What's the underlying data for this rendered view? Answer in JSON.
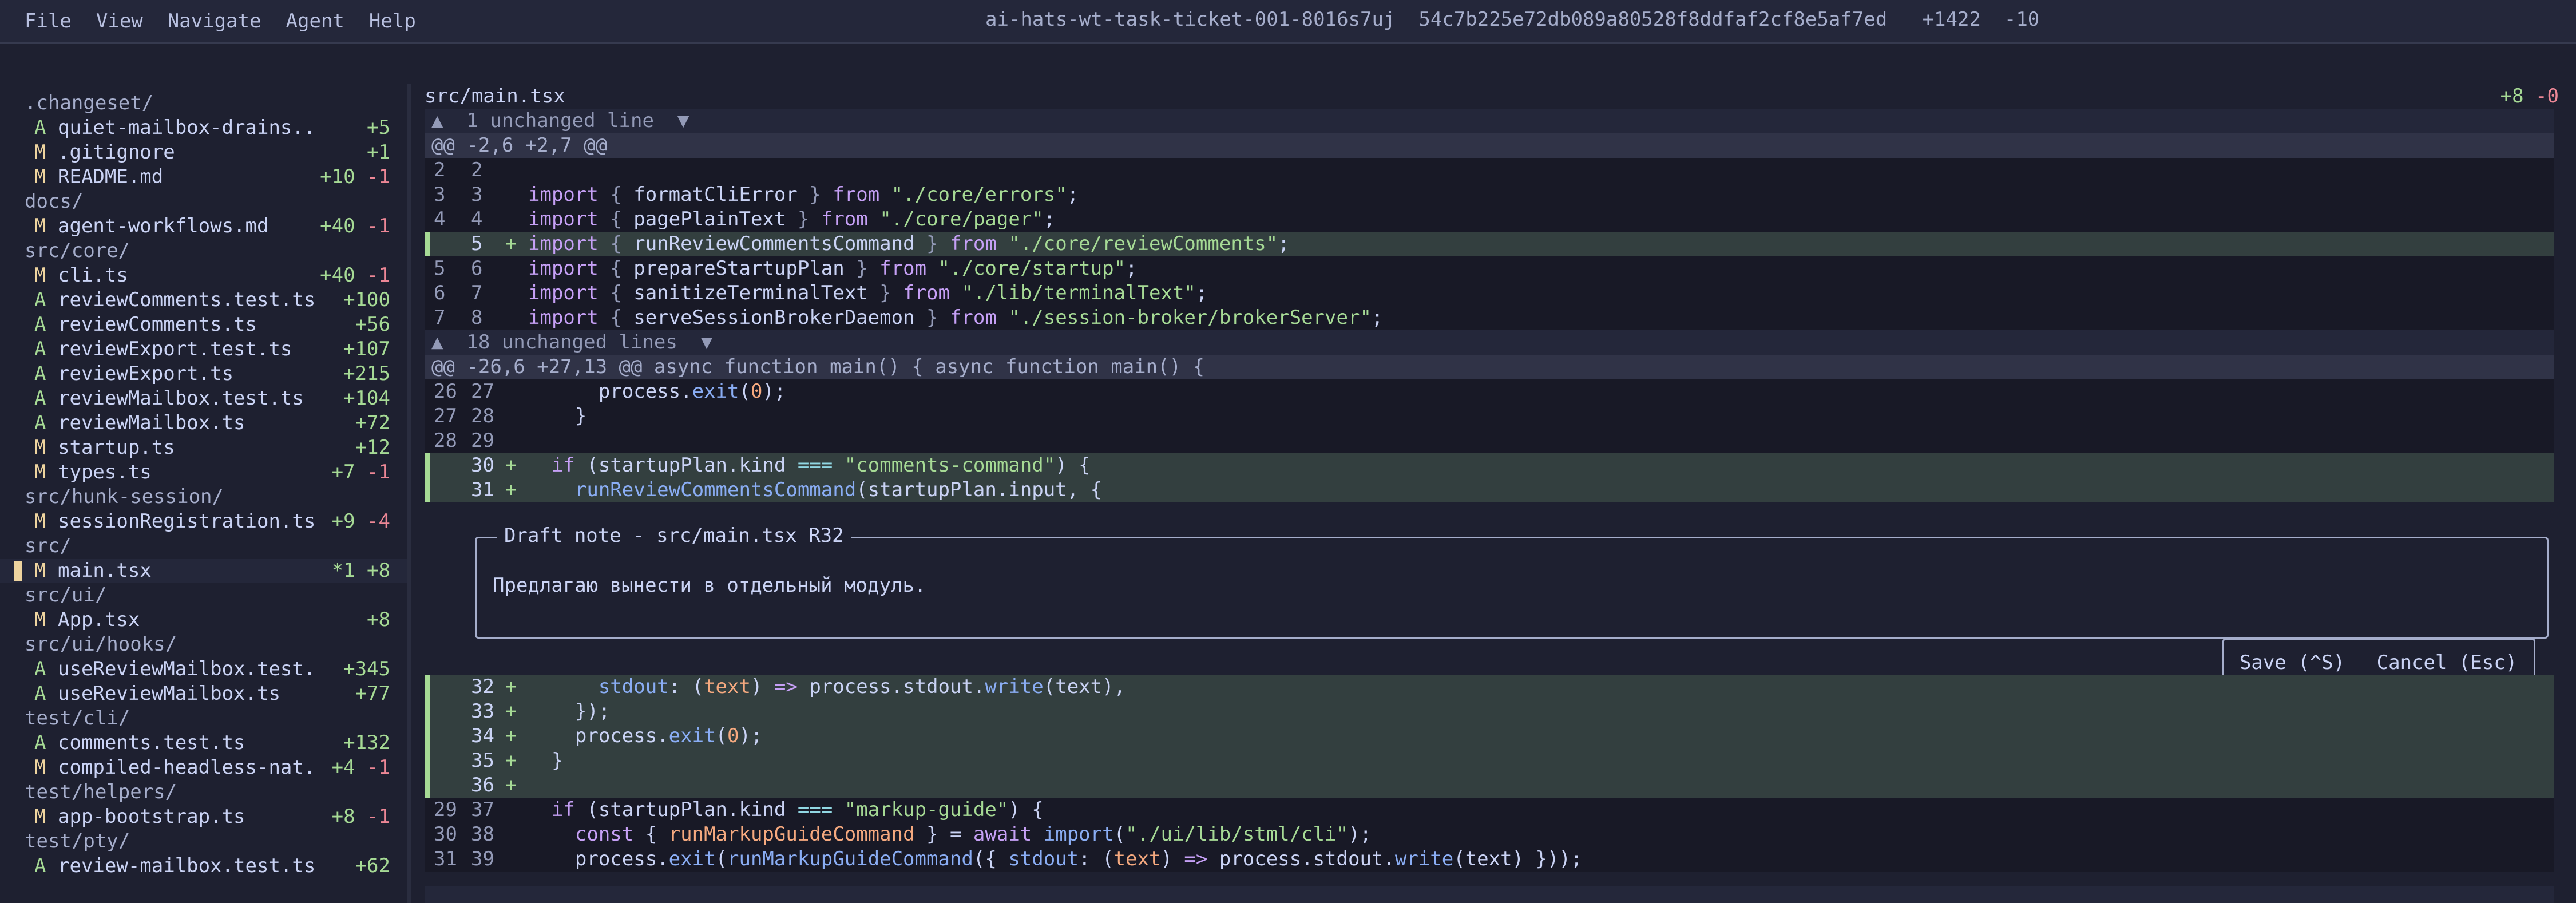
{
  "menu": [
    "File",
    "View",
    "Navigate",
    "Agent",
    "Help"
  ],
  "window_title": "ai-hats-wt-task-ticket-001-8016s7uj  54c7b225e72db089a80528f8ddfaf2cf8e5af7ed   +1422  -10",
  "sidebar": [
    {
      "type": "dir",
      "name": ".changeset/"
    },
    {
      "type": "file",
      "status": "A",
      "name": "quiet-mailbox-drains..",
      "add": "+5",
      "del": ""
    },
    {
      "type": "file",
      "status": "M",
      "name": ".gitignore",
      "add": "+1",
      "del": ""
    },
    {
      "type": "file",
      "status": "M",
      "name": "README.md",
      "add": "+10",
      "del": "-1"
    },
    {
      "type": "dir",
      "name": "docs/"
    },
    {
      "type": "file",
      "status": "M",
      "name": "agent-workflows.md",
      "add": "+40",
      "del": "-1"
    },
    {
      "type": "dir",
      "name": "src/core/"
    },
    {
      "type": "file",
      "status": "M",
      "name": "cli.ts",
      "add": "+40",
      "del": "-1"
    },
    {
      "type": "file",
      "status": "A",
      "name": "reviewComments.test.ts",
      "add": "+100",
      "del": ""
    },
    {
      "type": "file",
      "status": "A",
      "name": "reviewComments.ts",
      "add": "+56",
      "del": ""
    },
    {
      "type": "file",
      "status": "A",
      "name": "reviewExport.test.ts",
      "add": "+107",
      "del": ""
    },
    {
      "type": "file",
      "status": "A",
      "name": "reviewExport.ts",
      "add": "+215",
      "del": ""
    },
    {
      "type": "file",
      "status": "A",
      "name": "reviewMailbox.test.ts",
      "add": "+104",
      "del": ""
    },
    {
      "type": "file",
      "status": "A",
      "name": "reviewMailbox.ts",
      "add": "+72",
      "del": ""
    },
    {
      "type": "file",
      "status": "M",
      "name": "startup.ts",
      "add": "+12",
      "del": ""
    },
    {
      "type": "file",
      "status": "M",
      "name": "types.ts",
      "add": "+7",
      "del": "-1"
    },
    {
      "type": "dir",
      "name": "src/hunk-session/"
    },
    {
      "type": "file",
      "status": "M",
      "name": "sessionRegistration.ts",
      "add": "+9",
      "del": "-4"
    },
    {
      "type": "dir",
      "name": "src/"
    },
    {
      "type": "file",
      "status": "M",
      "name": "main.tsx",
      "add": "*1 +8",
      "del": "",
      "selected": true
    },
    {
      "type": "dir",
      "name": "src/ui/"
    },
    {
      "type": "file",
      "status": "M",
      "name": "App.tsx",
      "add": "+8",
      "del": ""
    },
    {
      "type": "dir",
      "name": "src/ui/hooks/"
    },
    {
      "type": "file",
      "status": "A",
      "name": "useReviewMailbox.test.",
      "add": "+345",
      "del": ""
    },
    {
      "type": "file",
      "status": "A",
      "name": "useReviewMailbox.ts",
      "add": "+77",
      "del": ""
    },
    {
      "type": "dir",
      "name": "test/cli/"
    },
    {
      "type": "file",
      "status": "A",
      "name": "comments.test.ts",
      "add": "+132",
      "del": ""
    },
    {
      "type": "file",
      "status": "M",
      "name": "compiled-headless-nat.",
      "add": "+4",
      "del": "-1"
    },
    {
      "type": "dir",
      "name": "test/helpers/"
    },
    {
      "type": "file",
      "status": "M",
      "name": "app-bootstrap.ts",
      "add": "+8",
      "del": "-1"
    },
    {
      "type": "dir",
      "name": "test/pty/"
    },
    {
      "type": "file",
      "status": "A",
      "name": "review-mailbox.test.ts",
      "add": "+62",
      "del": ""
    }
  ],
  "diff": {
    "file": "src/main.tsx",
    "add": "+8",
    "del": "-0",
    "fold1": "▲  1 unchanged line  ▼",
    "hunk1": "@@ -2,6 +2,7 @@",
    "fold2": "▲  18 unchanged lines  ▼",
    "hunk2": "@@ -26,6 +27,13 @@ async function main() { async function main() {"
  },
  "note": {
    "legend": "Draft note - src/main.tsx R32",
    "body": "Предлагаю вынести в отдельный модуль.",
    "save": "Save (^S)",
    "cancel": "Cancel (Esc)"
  },
  "lines": [
    {
      "ln1": "2",
      "ln2": "2",
      "sign": "",
      "code": ""
    },
    {
      "ln1": "3",
      "ln2": "3",
      "sign": "",
      "code": "import { formatCliError } from \"./core/errors\";"
    },
    {
      "ln1": "4",
      "ln2": "4",
      "sign": "",
      "code": "import { pagePlainText } from \"./core/pager\";"
    },
    {
      "ln1": "",
      "ln2": "5",
      "sign": "+",
      "code": "import { runReviewCommentsCommand } from \"./core/reviewComments\";"
    },
    {
      "ln1": "5",
      "ln2": "6",
      "sign": "",
      "code": "import { prepareStartupPlan } from \"./core/startup\";"
    },
    {
      "ln1": "6",
      "ln2": "7",
      "sign": "",
      "code": "import { sanitizeTerminalText } from \"./lib/terminalText\";"
    },
    {
      "ln1": "7",
      "ln2": "8",
      "sign": "",
      "code": "import { serveSessionBrokerDaemon } from \"./session-broker/brokerServer\";"
    },
    {
      "ln1": "26",
      "ln2": "27",
      "sign": "",
      "code": "      process.exit(0);"
    },
    {
      "ln1": "27",
      "ln2": "28",
      "sign": "",
      "code": "    }"
    },
    {
      "ln1": "28",
      "ln2": "29",
      "sign": "",
      "code": ""
    },
    {
      "ln1": "",
      "ln2": "30",
      "sign": "+",
      "code": "  if (startupPlan.kind === \"comments-command\") {"
    },
    {
      "ln1": "",
      "ln2": "31",
      "sign": "+",
      "code": "    runReviewCommentsCommand(startupPlan.input, {"
    },
    {
      "ln1": "",
      "ln2": "32",
      "sign": "+",
      "code": "      stdout: (text) => process.stdout.write(text),"
    },
    {
      "ln1": "",
      "ln2": "33",
      "sign": "+",
      "code": "    });"
    },
    {
      "ln1": "",
      "ln2": "34",
      "sign": "+",
      "code": "    process.exit(0);"
    },
    {
      "ln1": "",
      "ln2": "35",
      "sign": "+",
      "code": "  }"
    },
    {
      "ln1": "",
      "ln2": "36",
      "sign": "+",
      "code": ""
    },
    {
      "ln1": "29",
      "ln2": "37",
      "sign": "",
      "code": "  if (startupPlan.kind === \"markup-guide\") {"
    },
    {
      "ln1": "30",
      "ln2": "38",
      "sign": "",
      "code": "    const { runMarkupGuideCommand } = await import(\"./ui/lib/stml/cli\");"
    },
    {
      "ln1": "31",
      "ln2": "39",
      "sign": "",
      "code": "    process.exit(runMarkupGuideCommand({ stdout: (text) => process.stdout.write(text) }));"
    }
  ]
}
